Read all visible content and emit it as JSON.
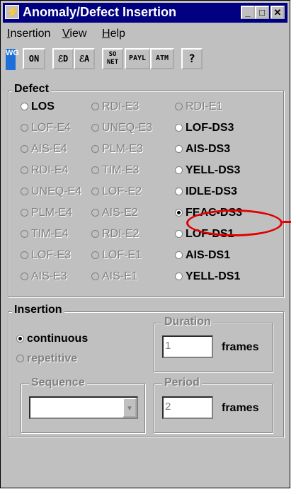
{
  "window": {
    "title": "Anomaly/Defect Insertion",
    "sys_icon": "⚡"
  },
  "menu": [
    "Insertion",
    "View",
    "Help"
  ],
  "toolbar": {
    "wg": "WG",
    "on": "ON",
    "d": "ℰD",
    "a": "ℰA",
    "sonet": "SO NET",
    "payl": "PAYL",
    "atm": "ATM",
    "help": "?"
  },
  "defect": {
    "label": "Defect",
    "columns": [
      [
        {
          "text": "LOS",
          "enabled": true,
          "checked": false
        },
        {
          "text": "LOF-E4",
          "enabled": false,
          "checked": false
        },
        {
          "text": "AIS-E4",
          "enabled": false,
          "checked": false
        },
        {
          "text": "RDI-E4",
          "enabled": false,
          "checked": false
        },
        {
          "text": "UNEQ-E4",
          "enabled": false,
          "checked": false
        },
        {
          "text": "PLM-E4",
          "enabled": false,
          "checked": false
        },
        {
          "text": "TIM-E4",
          "enabled": false,
          "checked": false
        },
        {
          "text": "LOF-E3",
          "enabled": false,
          "checked": false
        },
        {
          "text": "AIS-E3",
          "enabled": false,
          "checked": false
        }
      ],
      [
        {
          "text": "RDI-E3",
          "enabled": false,
          "checked": false
        },
        {
          "text": "UNEQ-E3",
          "enabled": false,
          "checked": false
        },
        {
          "text": "PLM-E3",
          "enabled": false,
          "checked": false
        },
        {
          "text": "TIM-E3",
          "enabled": false,
          "checked": false
        },
        {
          "text": "LOF-E2",
          "enabled": false,
          "checked": false
        },
        {
          "text": "AIS-E2",
          "enabled": false,
          "checked": false
        },
        {
          "text": "RDI-E2",
          "enabled": false,
          "checked": false
        },
        {
          "text": "LOF-E1",
          "enabled": false,
          "checked": false
        },
        {
          "text": "AIS-E1",
          "enabled": false,
          "checked": false
        }
      ],
      [
        {
          "text": "RDI-E1",
          "enabled": false,
          "checked": false
        },
        {
          "text": "LOF-DS3",
          "enabled": true,
          "checked": false
        },
        {
          "text": "AIS-DS3",
          "enabled": true,
          "checked": false
        },
        {
          "text": "YELL-DS3",
          "enabled": true,
          "checked": false
        },
        {
          "text": "IDLE-DS3",
          "enabled": true,
          "checked": false
        },
        {
          "text": "FEAC-DS3",
          "enabled": true,
          "checked": true
        },
        {
          "text": "LOF-DS1",
          "enabled": true,
          "checked": false
        },
        {
          "text": "AIS-DS1",
          "enabled": true,
          "checked": false
        },
        {
          "text": "YELL-DS1",
          "enabled": true,
          "checked": false
        }
      ]
    ]
  },
  "insertion": {
    "label": "Insertion",
    "continuous": "continuous",
    "repetitive": "repetitive",
    "duration_label": "Duration",
    "duration_value": "1",
    "duration_unit": "frames",
    "sequence_label": "Sequence",
    "sequence_value": "",
    "period_label": "Period",
    "period_value": "2",
    "period_unit": "frames"
  },
  "colors": {
    "titlebar": "#000080",
    "highlight": "#e00000",
    "face": "#c0c0c0"
  }
}
